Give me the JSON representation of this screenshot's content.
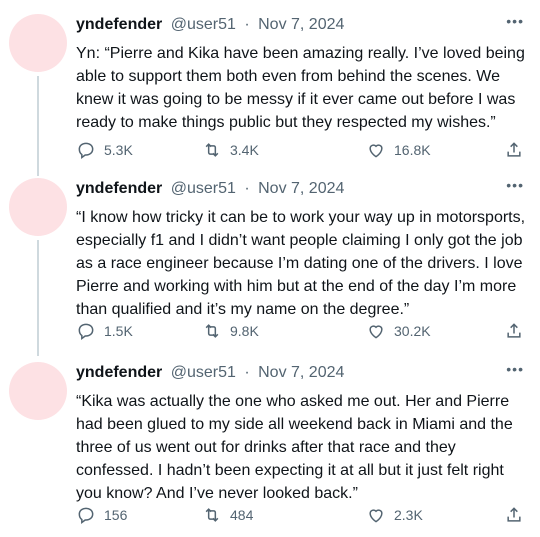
{
  "tweets": [
    {
      "name": "yndefender",
      "handle": "@user51",
      "sep": "·",
      "date": "Nov 7, 2024",
      "more": "•••",
      "text": "Yn: “Pierre and Kika have been amazing really. I’ve loved being able to support them both even from behind the scenes. We knew it was going to be messy if it ever came out before I was ready to make things public but they respected my wishes.”",
      "replies": "5.3K",
      "retweets": "3.4K",
      "likes": "16.8K"
    },
    {
      "name": "yndefender",
      "handle": "@user51",
      "sep": "·",
      "date": "Nov 7, 2024",
      "more": "•••",
      "text": "“I know how tricky it can be to work your way up in motorsports, especially f1 and I didn’t want people claiming I only got the job as a race engineer because I’m dating one of the drivers. I love Pierre and working with him but at the end of the day I’m more than qualified and it’s my name on the degree.”",
      "replies": "1.5K",
      "retweets": "9.8K",
      "likes": "30.2K"
    },
    {
      "name": "yndefender",
      "handle": "@user51",
      "sep": "·",
      "date": "Nov 7, 2024",
      "more": "•••",
      "text": "“Kika was actually the one who asked me out. Her and Pierre had been glued to my side all weekend back in Miami and the three of us went out for drinks after that race and they confessed. I hadn’t been expecting it at all but it just felt right you know? And I’ve never looked back.”",
      "replies": "156",
      "retweets": "484",
      "likes": "2.3K"
    }
  ],
  "colors": {
    "avatar": "#fde1e4",
    "thread_line": "#cfd9de",
    "meta": "#536471",
    "text": "#0f1419"
  },
  "icons": [
    "reply-icon",
    "retweet-icon",
    "like-icon",
    "share-icon",
    "more-icon"
  ]
}
